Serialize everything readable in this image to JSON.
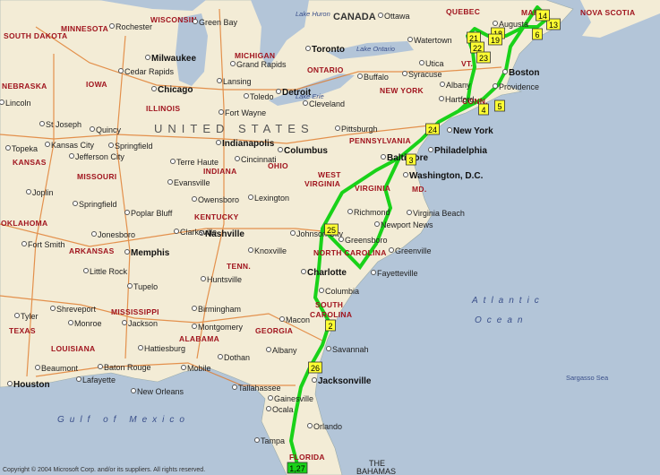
{
  "colors": {
    "water": "#b3c5d8",
    "land": "#f3ecd6",
    "route": "#19d219",
    "highway": "#e07a2a",
    "stop": "#ffff33"
  },
  "countries": [
    "CANADA",
    "UNITED STATES"
  ],
  "water_labels": [
    "Atlantic",
    "Ocean",
    "Gulf of Mexico",
    "Sargasso Sea",
    "Lake Huron",
    "Lake Ontario",
    "Lake Erie"
  ],
  "states": [
    [
      "SOUTH DAKOTA",
      4,
      35
    ],
    [
      "MINNESOTA",
      68,
      27
    ],
    [
      "WISCONSIN",
      168,
      17
    ],
    [
      "MICHIGAN",
      262,
      57
    ],
    [
      "ONTARIO",
      343,
      73
    ],
    [
      "QUEBEC",
      498,
      8
    ],
    [
      "MAINE",
      582,
      9
    ],
    [
      "NOVA SCOTIA",
      648,
      9
    ],
    [
      "NEBRASKA",
      2,
      91
    ],
    [
      "IOWA",
      96,
      89
    ],
    [
      "ILLINOIS",
      163,
      116
    ],
    [
      "INDIANA",
      227,
      186
    ],
    [
      "OHIO",
      299,
      180
    ],
    [
      "PENNSYLVANIA",
      390,
      152
    ],
    [
      "NEW YORK",
      424,
      96
    ],
    [
      "VT.",
      515,
      66
    ],
    [
      "CONN.",
      516,
      108
    ],
    [
      "KANSAS",
      14,
      176
    ],
    [
      "MISSOURI",
      86,
      192
    ],
    [
      "KENTUCKY",
      217,
      237
    ],
    [
      "WEST",
      355,
      190
    ],
    [
      "VIRGINIA",
      340,
      200
    ],
    [
      "VIRGINIA",
      396,
      205
    ],
    [
      "MD.",
      460,
      206
    ],
    [
      "OKLAHOMA",
      1,
      244
    ],
    [
      "ARKANSAS",
      77,
      275
    ],
    [
      "TENN.",
      253,
      292
    ],
    [
      "NORTH CAROLINA",
      350,
      277
    ],
    [
      "SOUTH",
      352,
      335
    ],
    [
      "CAROLINA",
      346,
      346
    ],
    [
      "TEXAS",
      10,
      364
    ],
    [
      "MISSISSIPPI",
      124,
      343
    ],
    [
      "ALABAMA",
      200,
      373
    ],
    [
      "GEORGIA",
      285,
      364
    ],
    [
      "LOUISIANA",
      57,
      384
    ],
    [
      "FLORIDA",
      323,
      505
    ]
  ],
  "cities": [
    [
      "Ottawa",
      428,
      13
    ],
    [
      "Green Bay",
      221,
      20
    ],
    [
      "Rochester",
      128,
      25
    ],
    [
      "Toronto",
      347,
      50
    ],
    [
      "Milwaukee",
      168,
      60
    ],
    [
      "Grand Rapids",
      263,
      67
    ],
    [
      "Watertown",
      461,
      40
    ],
    [
      "Augusta",
      556,
      22
    ],
    [
      "Cedar Rapids",
      138,
      75
    ],
    [
      "Lansing",
      248,
      86
    ],
    [
      "Detroit",
      314,
      98
    ],
    [
      "Buffalo",
      405,
      81
    ],
    [
      "Syracuse",
      455,
      78
    ],
    [
      "Utica",
      474,
      66
    ],
    [
      "Chicago",
      175,
      95
    ],
    [
      "Toledo",
      278,
      103
    ],
    [
      "Cleveland",
      344,
      111
    ],
    [
      "Albany",
      497,
      90
    ],
    [
      "Boston",
      567,
      76
    ],
    [
      "Lincoln",
      5,
      110
    ],
    [
      "Providence",
      556,
      92
    ],
    [
      "Hartford",
      496,
      106
    ],
    [
      "Fort Wayne",
      250,
      121
    ],
    [
      "Pittsburgh",
      380,
      139
    ],
    [
      "New York",
      505,
      141
    ],
    [
      "St Joseph",
      50,
      134
    ],
    [
      "Quincy",
      106,
      140
    ],
    [
      "Kansas City",
      56,
      157
    ],
    [
      "Springfield",
      127,
      158
    ],
    [
      "Indianapolis",
      247,
      155
    ],
    [
      "Columbus",
      316,
      163
    ],
    [
      "Philadelphia",
      484,
      163
    ],
    [
      "Topeka",
      12,
      161
    ],
    [
      "Jefferson City",
      83,
      170
    ],
    [
      "Terre Haute",
      196,
      176
    ],
    [
      "Cincinnati",
      268,
      173
    ],
    [
      "Baltimore",
      431,
      171
    ],
    [
      "Washington, D.C.",
      456,
      191
    ],
    [
      "Evansville",
      193,
      199
    ],
    [
      "Lexington",
      283,
      216
    ],
    [
      "Springfield",
      87,
      223
    ],
    [
      "Owensboro",
      220,
      218
    ],
    [
      "Joplin",
      35,
      210
    ],
    [
      "Poplar Bluff",
      145,
      233
    ],
    [
      "Richmond",
      394,
      232
    ],
    [
      "Virginia Beach",
      460,
      233
    ],
    [
      "Nashville",
      228,
      256
    ],
    [
      "Clarksville",
      200,
      254
    ],
    [
      "Johnson City",
      330,
      256
    ],
    [
      "Newport News",
      424,
      246
    ],
    [
      "Greensboro",
      384,
      263
    ],
    [
      "Fort Smith",
      30,
      268
    ],
    [
      "Jonesboro",
      108,
      257
    ],
    [
      "Memphis",
      145,
      277
    ],
    [
      "Knoxville",
      283,
      275
    ],
    [
      "Greenville",
      440,
      275
    ],
    [
      "Little Rock",
      99,
      298
    ],
    [
      "Charlotte",
      342,
      299
    ],
    [
      "Fayetteville",
      420,
      300
    ],
    [
      "Tupelo",
      148,
      315
    ],
    [
      "Huntsville",
      230,
      307
    ],
    [
      "Birmingham",
      220,
      340
    ],
    [
      "Columbia",
      362,
      320
    ],
    [
      "Shreveport",
      62,
      340
    ],
    [
      "Monroe",
      82,
      356
    ],
    [
      "Jackson",
      142,
      356
    ],
    [
      "Montgomery",
      220,
      360
    ],
    [
      "Macon",
      318,
      352
    ],
    [
      "Tyler",
      22,
      348
    ],
    [
      "Savannah",
      370,
      385
    ],
    [
      "Albany",
      303,
      386
    ],
    [
      "Dothan",
      249,
      394
    ],
    [
      "Hattiesburg",
      160,
      384
    ],
    [
      "Lafayette",
      91,
      419
    ],
    [
      "Baton Rouge",
      115,
      405
    ],
    [
      "Beaumont",
      45,
      406
    ],
    [
      "Houston",
      14,
      424
    ],
    [
      "Mobile",
      208,
      406
    ],
    [
      "Tallahassee",
      265,
      428
    ],
    [
      "New Orleans",
      152,
      432
    ],
    [
      "Jacksonville",
      354,
      420
    ],
    [
      "Gainesville",
      305,
      440
    ],
    [
      "Ocala",
      303,
      452
    ],
    [
      "Orlando",
      349,
      471
    ],
    [
      "Tampa",
      290,
      487
    ]
  ],
  "stops": [
    [
      "1,27",
      332,
      522,
      "#19d219"
    ],
    [
      "2",
      369,
      363
    ],
    [
      "3",
      459,
      178
    ],
    [
      "4",
      540,
      122
    ],
    [
      "5",
      558,
      118
    ],
    [
      "6",
      600,
      38
    ],
    [
      "13",
      618,
      27
    ],
    [
      "14",
      606,
      17
    ],
    [
      "18",
      556,
      37
    ],
    [
      "19",
      553,
      44
    ],
    [
      "21",
      529,
      42
    ],
    [
      "22",
      533,
      53
    ],
    [
      "23",
      540,
      64
    ],
    [
      "24",
      483,
      144
    ],
    [
      "25",
      370,
      256
    ],
    [
      "26",
      352,
      410
    ]
  ],
  "labels": {
    "atlantic": "Atlantic",
    "ocean": "Ocean",
    "gulf": "Gulf of Mexico",
    "sargasso": "Sargasso Sea",
    "bahamas1": "THE",
    "bahamas2": "BAHAMAS",
    "canada": "CANADA",
    "us": "UNITED STATES"
  },
  "copyright": "Copyright © 2004 Microsoft Corp. and/or its suppliers. All rights reserved."
}
